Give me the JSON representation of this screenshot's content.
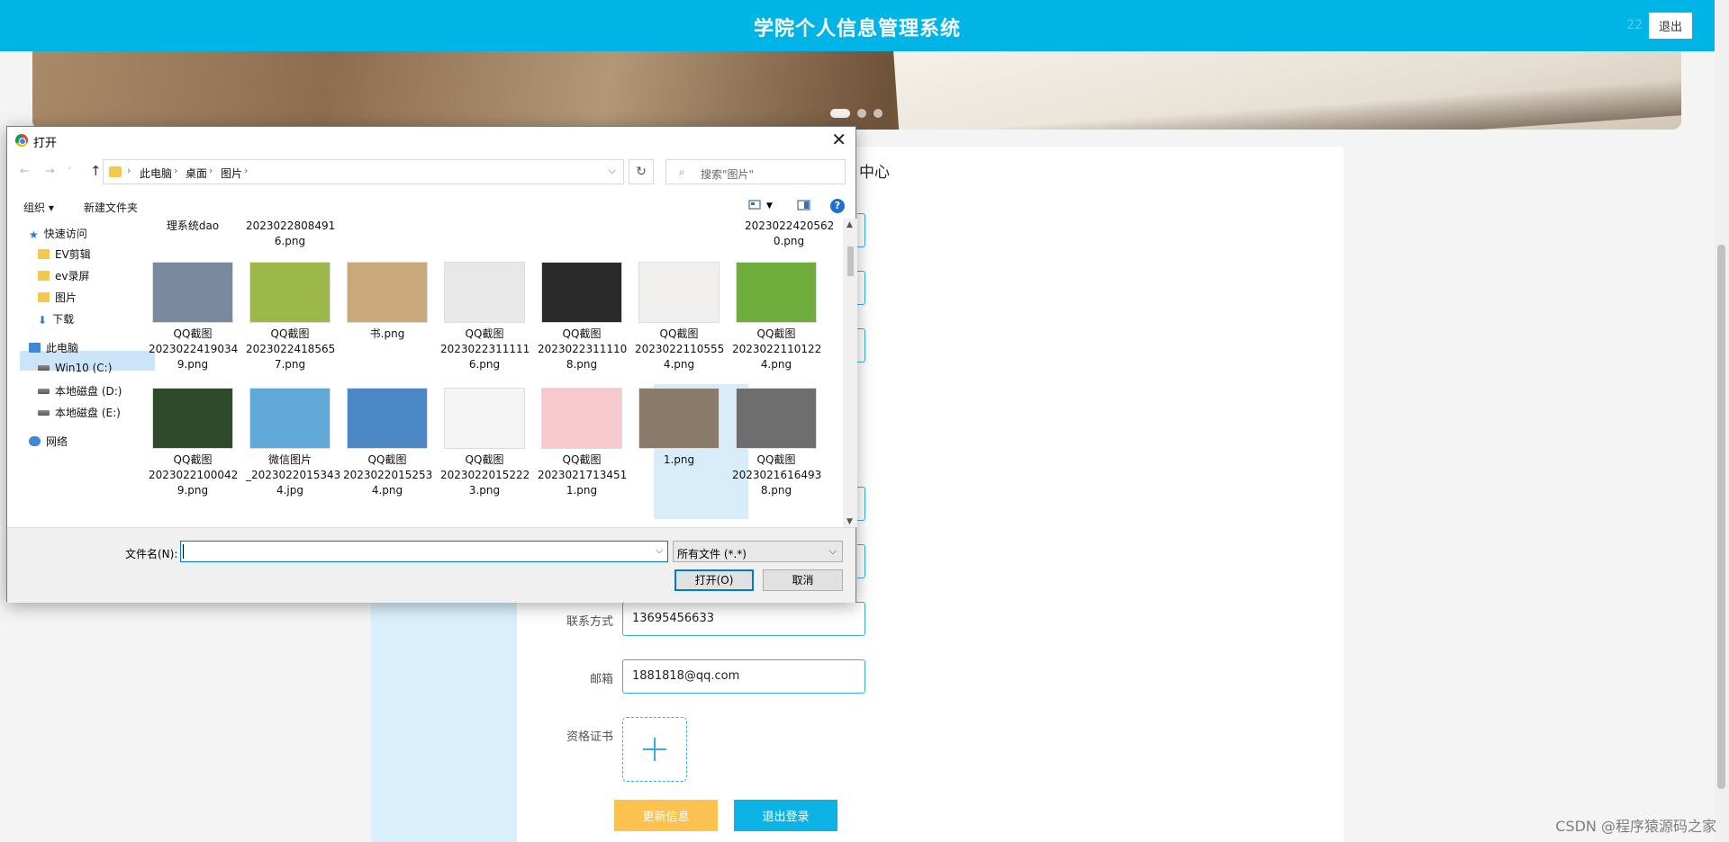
{
  "header": {
    "title": "学院个人信息管理系统",
    "user": "22",
    "logout_label": "退出"
  },
  "page": {
    "subtitle": "中心",
    "fields": [
      {
        "label": "联系方式",
        "value": "13695456633"
      },
      {
        "label": "邮箱",
        "value": "1881818@qq.com"
      }
    ],
    "certificate_label": "资格证书",
    "update_button": "更新信息",
    "logout_button": "退出登录",
    "watermark": "CSDN @程序猿源码之家"
  },
  "dialog": {
    "title": "打开",
    "breadcrumb": [
      "此电脑",
      "桌面",
      "图片"
    ],
    "search_placeholder": "搜索\"图片\"",
    "organize_label": "组织 ▾",
    "new_folder_label": "新建文件夹",
    "nav_items": [
      {
        "label": "快速访问"
      },
      {
        "label": "EV剪辑"
      },
      {
        "label": "ev录屏"
      },
      {
        "label": "图片"
      },
      {
        "label": "下载"
      },
      {
        "label": "此电脑"
      },
      {
        "label": "Win10 (C:)"
      },
      {
        "label": "本地磁盘 (D:)"
      },
      {
        "label": "本地磁盘 (E:)"
      },
      {
        "label": "网络"
      }
    ],
    "top_row_labels": [
      "理系统dao",
      "2023022808491\n6.png",
      "2023022420562\n0.png"
    ],
    "files_row1": [
      {
        "name": "QQ截图\n2023022419034\n9.png",
        "color": "#7a8a9e"
      },
      {
        "name": "QQ截图\n2023022418565\n7.png",
        "color": "#9cb84a"
      },
      {
        "name": "书.png",
        "color": "#c9a97a"
      },
      {
        "name": "QQ截图\n2023022311111\n6.png",
        "color": "#e8e8e8"
      },
      {
        "name": "QQ截图\n2023022311110\n8.png",
        "color": "#2a2a2a"
      },
      {
        "name": "QQ截图\n2023022110555\n4.png",
        "color": "#f2f0ee"
      },
      {
        "name": "QQ截图\n2023022110122\n4.png",
        "color": "#6fae3c"
      }
    ],
    "files_row2": [
      {
        "name": "QQ截图\n2023022100042\n9.png",
        "color": "#2e4a2a"
      },
      {
        "name": "微信图片\n_2023022015343\n4.jpg",
        "color": "#5fa8d8"
      },
      {
        "name": "QQ截图\n2023022015253\n4.png",
        "color": "#4b86c5"
      },
      {
        "name": "QQ截图\n2023022015222\n3.png",
        "color": "#f5f5f5"
      },
      {
        "name": "QQ截图\n2023021713451\n1.png",
        "color": "#f7c9cf"
      },
      {
        "name": "1.png",
        "color": "#8a7a6a"
      },
      {
        "name": "QQ截图\n2023021616493\n8.png",
        "color": "#6e6e6e"
      }
    ],
    "filename_label": "文件名(N):",
    "filename_value": "",
    "filetype_value": "所有文件 (*.*)",
    "open_button": "打开(O)",
    "cancel_button": "取消"
  }
}
